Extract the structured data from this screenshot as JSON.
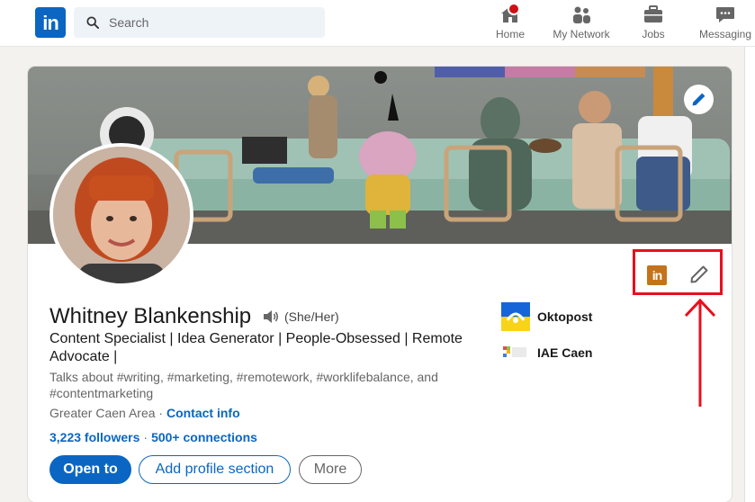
{
  "nav": {
    "search_placeholder": "Search",
    "logo_text": "in",
    "items": [
      {
        "label": "Home",
        "icon": "home-icon"
      },
      {
        "label": "My Network",
        "icon": "network-icon"
      },
      {
        "label": "Jobs",
        "icon": "briefcase-icon"
      },
      {
        "label": "Messaging",
        "icon": "messaging-icon"
      }
    ]
  },
  "profile": {
    "name": "Whitney Blankenship",
    "pronouns": "(She/Her)",
    "headline": "Content Specialist | Idea Generator | People-Obsessed | Remote Advocate |",
    "talks_about": "Talks about #writing, #marketing, #remotework, #worklifebalance, and #contentmarketing",
    "location": "Greater Caen Area",
    "location_sep": " · ",
    "contact_info": "Contact info",
    "followers": "3,223 followers",
    "connections": "500+ connections",
    "buttons": {
      "open_to": "Open to",
      "add_section": "Add profile section",
      "more": "More"
    },
    "organizations": [
      {
        "name": "Oktopost"
      },
      {
        "name": "IAE Caen"
      }
    ]
  },
  "annotation": {
    "badge_text": "in",
    "box_color": "#e8101c"
  },
  "colors": {
    "brand": "#0a66c2",
    "notification": "#cc1016",
    "annotation": "#e8101c",
    "annotation_badge": "#c3731b"
  }
}
